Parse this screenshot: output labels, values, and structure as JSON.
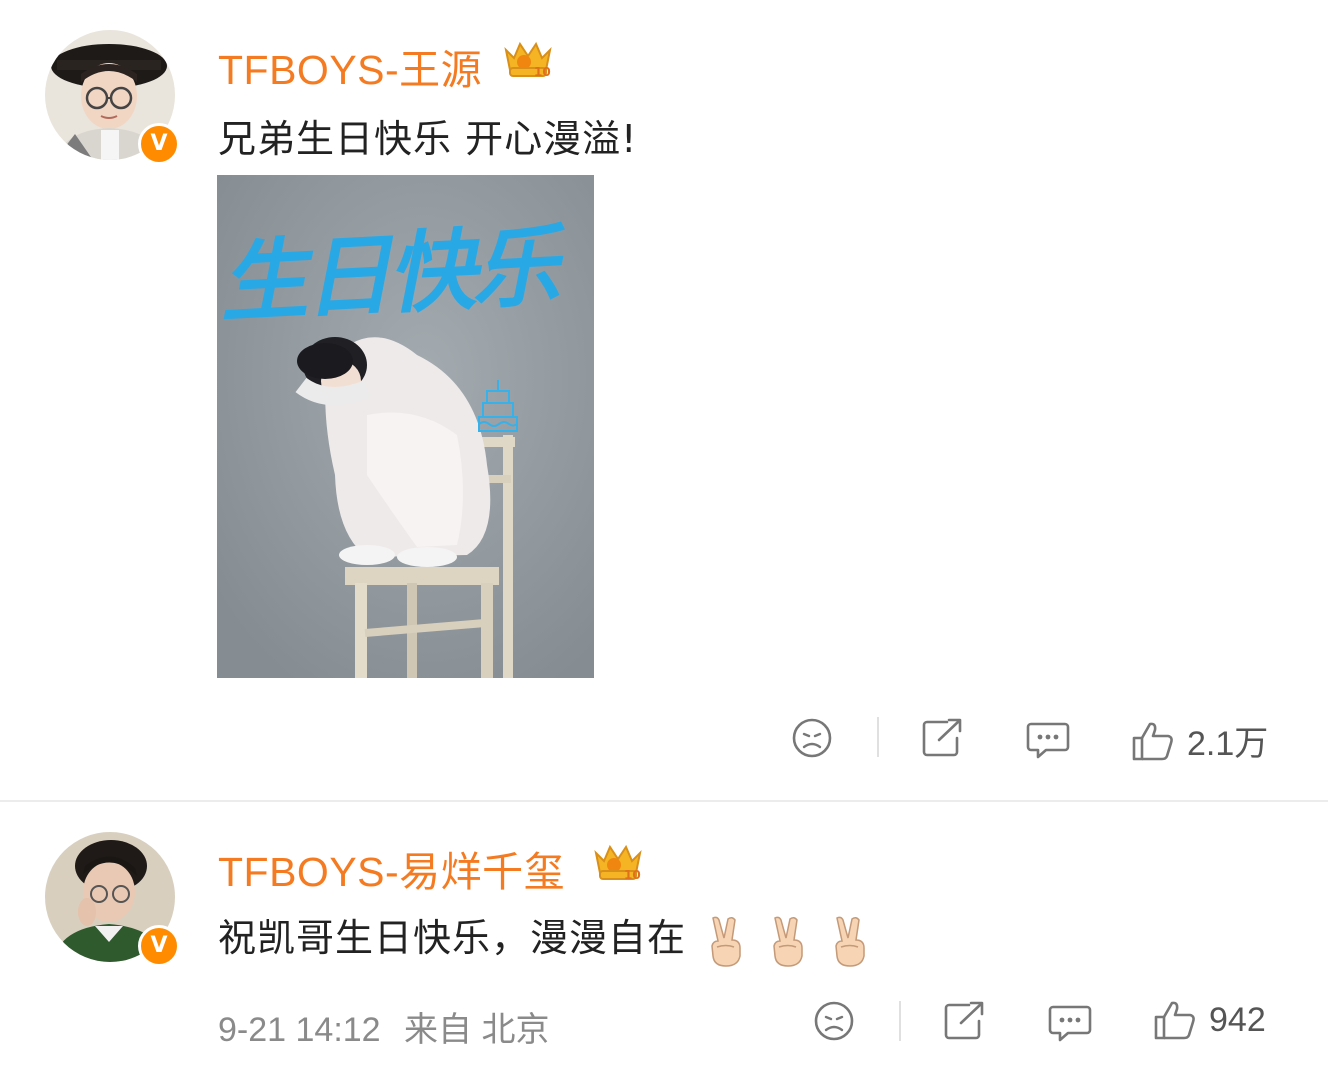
{
  "posts": [
    {
      "username": "TFBOYS-王源",
      "content": "兄弟生日快乐 开心漫溢!",
      "image": {
        "overlay_text": "生日快乐"
      },
      "actions": {
        "dislike_icon": "frown-face-icon",
        "share_icon": "share-icon",
        "comment_icon": "comment-icon",
        "like_icon": "thumbs-up-icon",
        "like_count": "2.1万"
      }
    },
    {
      "username": "TFBOYS-易烊千玺",
      "content": "祝凯哥生日快乐，漫漫自在",
      "emojis": [
        "victory-hand-emoji",
        "victory-hand-emoji",
        "victory-hand-emoji"
      ],
      "meta": {
        "time": "9-21 14:12",
        "source": "来自 北京"
      },
      "actions": {
        "dislike_icon": "frown-face-icon",
        "share_icon": "share-icon",
        "comment_icon": "comment-icon",
        "like_icon": "thumbs-up-icon",
        "like_count": "942"
      }
    }
  ],
  "colors": {
    "username": "#f47b21",
    "verified_badge": "#ff8b00",
    "poster_text": "#29a8e6"
  }
}
